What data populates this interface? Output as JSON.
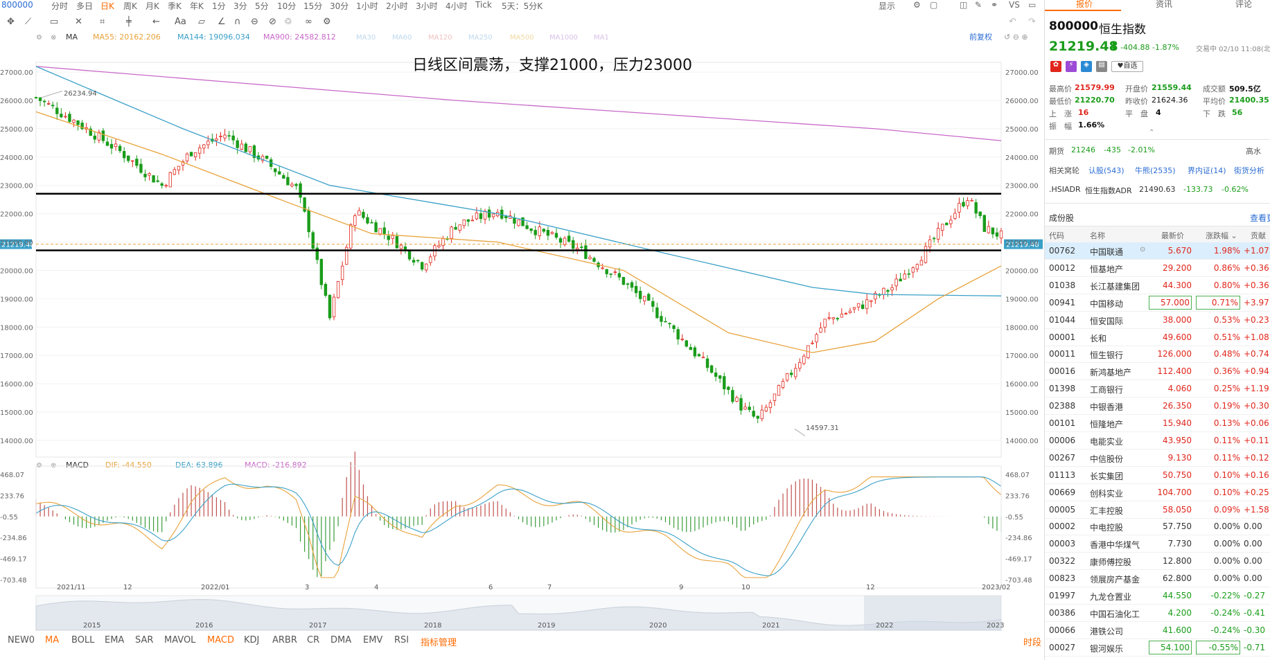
{
  "toolbar": {
    "code": "800000",
    "items": [
      "分时",
      "多日",
      "日K",
      "周K",
      "月K",
      "季K",
      "年K",
      "1分",
      "3分",
      "5分",
      "10分",
      "15分",
      "30分",
      "1小时",
      "2小时",
      "3小时",
      "4小时",
      "Tick",
      "5天：5分K"
    ],
    "display": "显示"
  },
  "main_chart": {
    "indicator": "MA",
    "ma55": {
      "label": "MA55: 20162.206",
      "color": "#e8a23a"
    },
    "ma144": {
      "label": "MA144: 19096.034",
      "color": "#3aa0c8"
    },
    "ma900": {
      "label": "MA900: 24582.812",
      "color": "#c868c8"
    },
    "faded": [
      "MA30",
      "MA60",
      "MA120",
      "MA250",
      "MA500",
      "MA1000",
      "MA1"
    ],
    "qfq": "前复权",
    "annotation": "日线区间震荡，支撑21000，压力23000",
    "high_label": "26234.94",
    "low_label": "14597.31",
    "current_label": "21219.48",
    "y_ticks": [
      "27000.00",
      "26000.00",
      "25000.00",
      "24000.00",
      "23000.00",
      "22000.00",
      "21000.00",
      "20000.00",
      "19000.00",
      "18000.00",
      "17000.00",
      "16000.00",
      "15000.00",
      "14000.00"
    ],
    "x_labels": [
      "2021/11",
      "12",
      "2022/01",
      "3",
      "4",
      "6",
      "7",
      "9",
      "10",
      "12",
      "2023/02"
    ]
  },
  "chart_data": {
    "type": "line",
    "title": "日线区间震荡，支撑21000，压力23000",
    "ylim": [
      13900,
      27100
    ],
    "support": 21000,
    "resistance": 23000,
    "close_points": [
      [
        0,
        26100
      ],
      [
        10,
        25200
      ],
      [
        20,
        24200
      ],
      [
        30,
        23000
      ],
      [
        37,
        24200
      ],
      [
        45,
        24800
      ],
      [
        55,
        23800
      ],
      [
        62,
        22900
      ],
      [
        65,
        21500
      ],
      [
        70,
        18300
      ],
      [
        76,
        22100
      ],
      [
        85,
        21100
      ],
      [
        92,
        20200
      ],
      [
        100,
        21600
      ],
      [
        110,
        22100
      ],
      [
        118,
        21500
      ],
      [
        130,
        20700
      ],
      [
        140,
        19600
      ],
      [
        150,
        18200
      ],
      [
        160,
        16600
      ],
      [
        168,
        15200
      ],
      [
        172,
        14700
      ],
      [
        180,
        16400
      ],
      [
        188,
        18200
      ],
      [
        196,
        18700
      ],
      [
        204,
        19400
      ],
      [
        212,
        20700
      ],
      [
        218,
        21900
      ],
      [
        222,
        22600
      ],
      [
        226,
        21500
      ],
      [
        230,
        21220
      ]
    ],
    "ma900": [
      [
        0,
        27200
      ],
      [
        50,
        26600
      ],
      [
        100,
        26000
      ],
      [
        150,
        25500
      ],
      [
        200,
        25000
      ],
      [
        230,
        24580
      ]
    ],
    "ma144": [
      [
        0,
        27200
      ],
      [
        35,
        25000
      ],
      [
        70,
        23000
      ],
      [
        110,
        22000
      ],
      [
        150,
        20600
      ],
      [
        185,
        19400
      ],
      [
        200,
        19150
      ],
      [
        230,
        19100
      ]
    ],
    "ma55": [
      [
        0,
        25600
      ],
      [
        30,
        24100
      ],
      [
        60,
        22400
      ],
      [
        80,
        21300
      ],
      [
        110,
        21000
      ],
      [
        140,
        20000
      ],
      [
        165,
        17800
      ],
      [
        185,
        17100
      ],
      [
        200,
        17500
      ],
      [
        215,
        19000
      ],
      [
        230,
        20160
      ]
    ]
  },
  "macd_panel": {
    "title": "MACD",
    "dif": "DIF: -44.550",
    "dea": "DEA: 63.896",
    "macd": "MACD: -216.892",
    "y_ticks": [
      "468.07",
      "233.76",
      "-0.55",
      "-234.86",
      "-469.17",
      "-703.48"
    ]
  },
  "overview": {
    "years": [
      "2015",
      "2016",
      "2017",
      "2018",
      "2019",
      "2020",
      "2021",
      "2022",
      "2023"
    ]
  },
  "bottom_tabs": [
    "NEW0",
    "MA",
    "BOLL",
    "EMA",
    "SAR",
    "MAVOL",
    "MACD",
    "KDJ",
    "ARBR",
    "CR",
    "DMA",
    "EMV",
    "RSI",
    "指标管理"
  ],
  "bottom_right": "时段",
  "panel": {
    "tabs": [
      "报价",
      "资讯",
      "评论"
    ],
    "code": "800000",
    "name": "恒生指数",
    "price": "21219.48",
    "change": "-404.88",
    "pct": "-1.87%",
    "status": "交易中 02/10 11:08(北",
    "self_select": "自选",
    "stats": [
      [
        "最高价",
        "21579.99"
      ],
      [
        "开盘价",
        "21559.44"
      ],
      [
        "成交额",
        "509.5亿"
      ],
      [
        "最低价",
        "21220.70"
      ],
      [
        "昨收价",
        "21624.36"
      ],
      [
        "平均价",
        "21400.35"
      ]
    ],
    "up_label": "上　涨",
    "up": "16",
    "flat_label": "平　盘",
    "flat": "4",
    "down_label": "下　跌",
    "down": "56",
    "amp_label": "振　幅",
    "amp": "1.66%",
    "futures": {
      "label": "期货",
      "price": "21246",
      "change": "-435",
      "pct": "-2.01%",
      "tag": "高水"
    },
    "related": {
      "label": "相关窝轮",
      "links": [
        "认股(543)",
        "牛熊(2535)",
        "界内证(14)",
        "街货分析"
      ]
    },
    "adr": {
      "code": ".HSIADR",
      "name": "恒生指数ADR",
      "price": "21490.63",
      "change": "-133.73",
      "pct": "-0.62%"
    },
    "constituents_title": "成份股",
    "more": "查看更",
    "headers": [
      "代码",
      "名称",
      "最新价",
      "涨跌幅",
      "贡献"
    ],
    "rows": [
      [
        "00762",
        "中国联通",
        "5.670",
        "1.98%",
        "+1.07"
      ],
      [
        "00012",
        "恒基地产",
        "29.200",
        "0.86%",
        "+0.36"
      ],
      [
        "01038",
        "长江基建集团",
        "44.300",
        "0.80%",
        "+0.36"
      ],
      [
        "00941",
        "中国移动",
        "57.000",
        "0.71%",
        "+3.97"
      ],
      [
        "01044",
        "恒安国际",
        "38.000",
        "0.53%",
        "+0.23"
      ],
      [
        "00001",
        "长和",
        "49.600",
        "0.51%",
        "+1.08"
      ],
      [
        "00011",
        "恒生银行",
        "126.000",
        "0.48%",
        "+0.74"
      ],
      [
        "00016",
        "新鸿基地产",
        "112.400",
        "0.36%",
        "+0.94"
      ],
      [
        "01398",
        "工商银行",
        "4.060",
        "0.25%",
        "+1.19"
      ],
      [
        "02388",
        "中银香港",
        "26.350",
        "0.19%",
        "+0.30"
      ],
      [
        "00101",
        "恒隆地产",
        "15.940",
        "0.13%",
        "+0.06"
      ],
      [
        "00006",
        "电能实业",
        "43.950",
        "0.11%",
        "+0.11"
      ],
      [
        "00267",
        "中信股份",
        "9.130",
        "0.11%",
        "+0.12"
      ],
      [
        "01113",
        "长实集团",
        "50.750",
        "0.10%",
        "+0.16"
      ],
      [
        "00669",
        "创科实业",
        "104.700",
        "0.10%",
        "+0.25"
      ],
      [
        "00005",
        "汇丰控股",
        "58.050",
        "0.09%",
        "+1.58"
      ],
      [
        "00002",
        "中电控股",
        "57.750",
        "0.00%",
        "0.00"
      ],
      [
        "00003",
        "香港中华煤气",
        "7.730",
        "0.00%",
        "0.00"
      ],
      [
        "00322",
        "康师傅控股",
        "12.800",
        "0.00%",
        "0.00"
      ],
      [
        "00823",
        "领展房产基金",
        "62.800",
        "0.00%",
        "0.00"
      ],
      [
        "01997",
        "九龙仓置业",
        "44.550",
        "-0.22%",
        "-0.27"
      ],
      [
        "00386",
        "中国石油化工",
        "4.200",
        "-0.24%",
        "-0.41"
      ],
      [
        "00066",
        "港铁公司",
        "41.600",
        "-0.24%",
        "-0.30"
      ],
      [
        "00027",
        "银河娱乐",
        "54.100",
        "-0.55%",
        "-0.71"
      ]
    ]
  }
}
